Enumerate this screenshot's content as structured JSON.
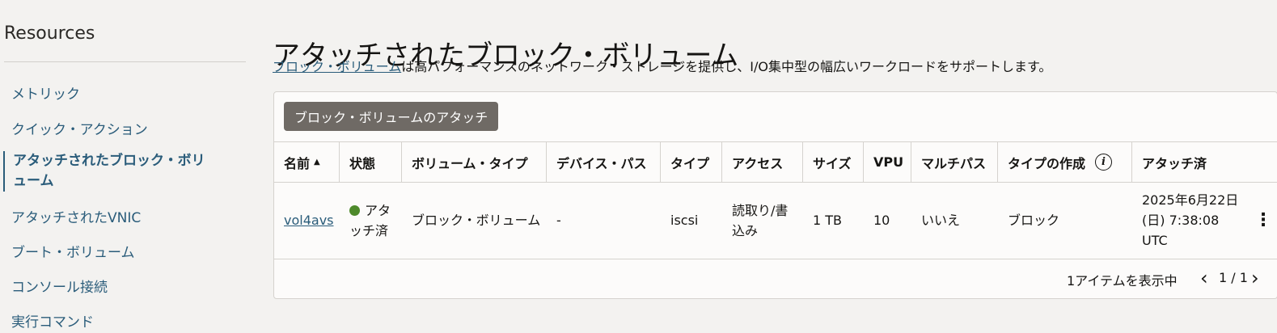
{
  "sidebar": {
    "title": "Resources",
    "items": [
      {
        "label": "メトリック"
      },
      {
        "label": "クイック・アクション"
      },
      {
        "label": "アタッチされたブロック・ボリューム",
        "active": true
      },
      {
        "label": "アタッチされたVNIC"
      },
      {
        "label": "ブート・ボリューム"
      },
      {
        "label": "コンソール接続"
      },
      {
        "label": "実行コマンド"
      }
    ]
  },
  "main": {
    "title": "アタッチされたブロック・ボリューム",
    "description_link": "ブロック・ボリューム",
    "description_rest": "は高パフォーマンスのネットワーク・ストレージを提供し、I/O集中型の幅広いワークロードをサポートします。",
    "attach_button": "ブロック・ボリュームのアタッチ"
  },
  "table": {
    "columns": [
      "名前",
      "状態",
      "ボリューム・タイプ",
      "デバイス・パス",
      "タイプ",
      "アクセス",
      "サイズ",
      "VPU",
      "マルチパス",
      "タイプの作成",
      "アタッチ済"
    ],
    "sort_indicator": "▲",
    "rows": [
      {
        "name": "vol4avs",
        "state": "アタッチ済",
        "volume_type": "ブロック・ボリューム",
        "device_path": "-",
        "type": "iscsi",
        "access": "読取り/書込み",
        "size": "1 TB",
        "vpu": "10",
        "multipath": "いいえ",
        "creation_type": "ブロック",
        "attached": "2025年6月22日(日) 7:38:08 UTC"
      }
    ],
    "state_color": "#4e8a2b"
  },
  "footer": {
    "count_text": "1アイテムを表示中",
    "page_text": "1 / 1"
  }
}
